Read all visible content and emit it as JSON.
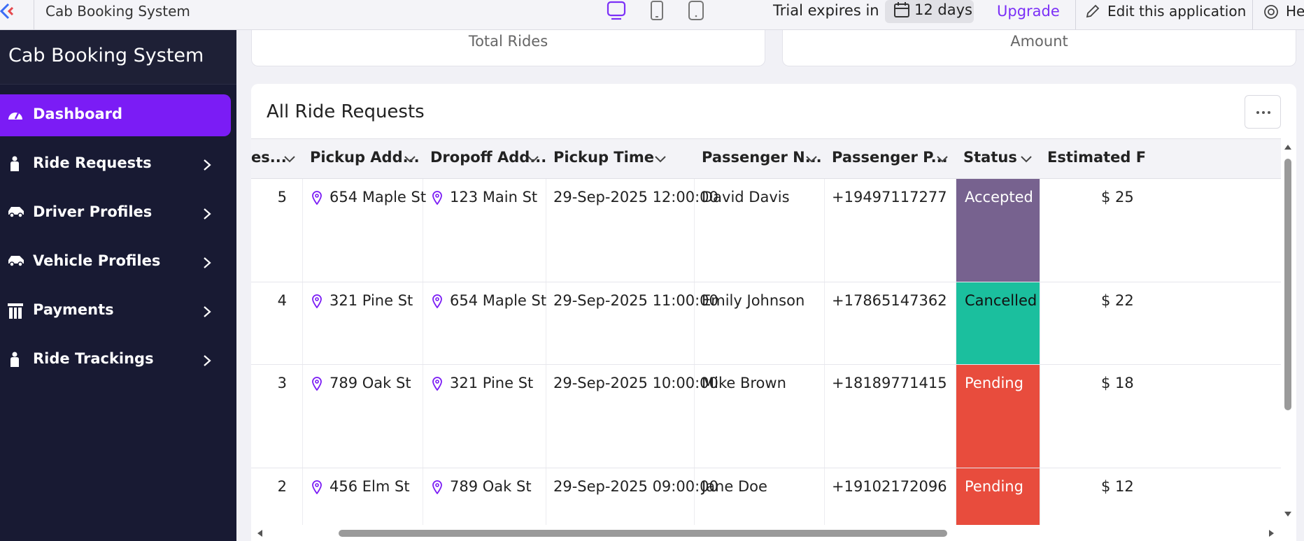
{
  "topbar": {
    "app_title": "Cab Booking System",
    "trial_text": "Trial expires in",
    "days": "12 days",
    "upgrade": "Upgrade",
    "edit_app": "Edit this application",
    "help": "He"
  },
  "sidebar": {
    "title": "Cab Booking System",
    "items": [
      {
        "label": "Dashboard",
        "icon": "gauge-icon",
        "active": true
      },
      {
        "label": "Ride Requests",
        "icon": "person-icon"
      },
      {
        "label": "Driver Profiles",
        "icon": "car-icon"
      },
      {
        "label": "Vehicle Profiles",
        "icon": "car-icon"
      },
      {
        "label": "Payments",
        "icon": "columns-icon"
      },
      {
        "label": "Ride Trackings",
        "icon": "person-icon"
      }
    ]
  },
  "stats": {
    "total_rides": "Total Rides",
    "amount": "Amount"
  },
  "panel": {
    "title": "All Ride Requests",
    "columns": [
      "es...",
      "Pickup Add...",
      "Dropoff Add...",
      "Pickup Time",
      "Passenger N...",
      "Passenger P...",
      "Status",
      "Estimated F"
    ],
    "rows": [
      {
        "id": "5",
        "pickup": "654 Maple St",
        "dropoff": "123 Main St",
        "time": "29-Sep-2025 12:00:00",
        "name": "David Davis",
        "phone": "+19497117277",
        "status": "Accepted",
        "fare": "$ 25"
      },
      {
        "id": "4",
        "pickup": "321 Pine St",
        "dropoff": "654 Maple St",
        "time": "29-Sep-2025 11:00:00",
        "name": "Emily Johnson",
        "phone": "+17865147362",
        "status": "Cancelled",
        "fare": "$ 22"
      },
      {
        "id": "3",
        "pickup": "789 Oak St",
        "dropoff": "321 Pine St",
        "time": "29-Sep-2025 10:00:00",
        "name": "Mike Brown",
        "phone": "+18189771415",
        "status": "Pending",
        "fare": "$ 18"
      },
      {
        "id": "2",
        "pickup": "456 Elm St",
        "dropoff": "789 Oak St",
        "time": "29-Sep-2025 09:00:00",
        "name": "Jane Doe",
        "phone": "+19102172096",
        "status": "Pending",
        "fare": "$ 12"
      }
    ]
  },
  "colors": {
    "accent": "#7b1cf5",
    "sidebar_bg": "#181a33",
    "status_accepted": "#77628f",
    "status_cancelled": "#1bbf9e",
    "status_pending": "#e84c3d"
  }
}
